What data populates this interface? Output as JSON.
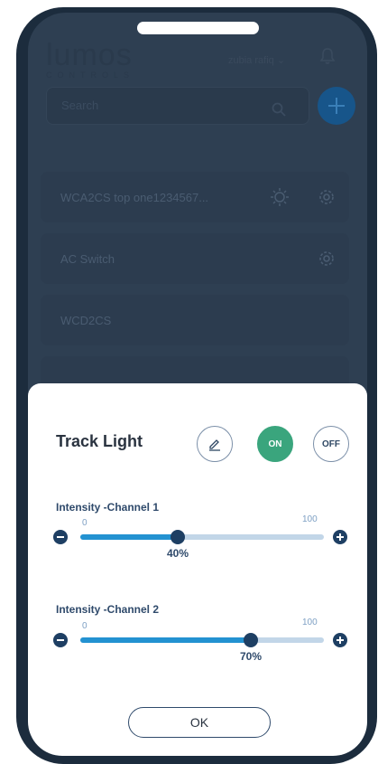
{
  "app": {
    "logo_word": "lumos",
    "logo_sub": "CONTROLS",
    "user_name": "zubia rafiq",
    "search_placeholder": "Search",
    "devices": [
      {
        "label": "WCA2CS top one1234567..."
      },
      {
        "label": "AC Switch"
      },
      {
        "label": "WCD2CS"
      }
    ]
  },
  "sheet": {
    "title": "Track Light",
    "on_label": "ON",
    "off_label": "OFF",
    "channels": [
      {
        "label": "Intensity -Channel 1",
        "min_label": "0",
        "max_label": "100",
        "value": 40,
        "value_label": "40%"
      },
      {
        "label": "Intensity -Channel 2",
        "min_label": "0",
        "max_label": "100",
        "value": 70,
        "value_label": "70%"
      }
    ],
    "ok_label": "OK"
  },
  "colors": {
    "frame": "#1c2c3d",
    "overlay": "#2e3f52",
    "on_green": "#3aa57d",
    "slider_fill": "#2392d1",
    "slider_track": "#c2d6e8",
    "thumb": "#1e3f63"
  }
}
